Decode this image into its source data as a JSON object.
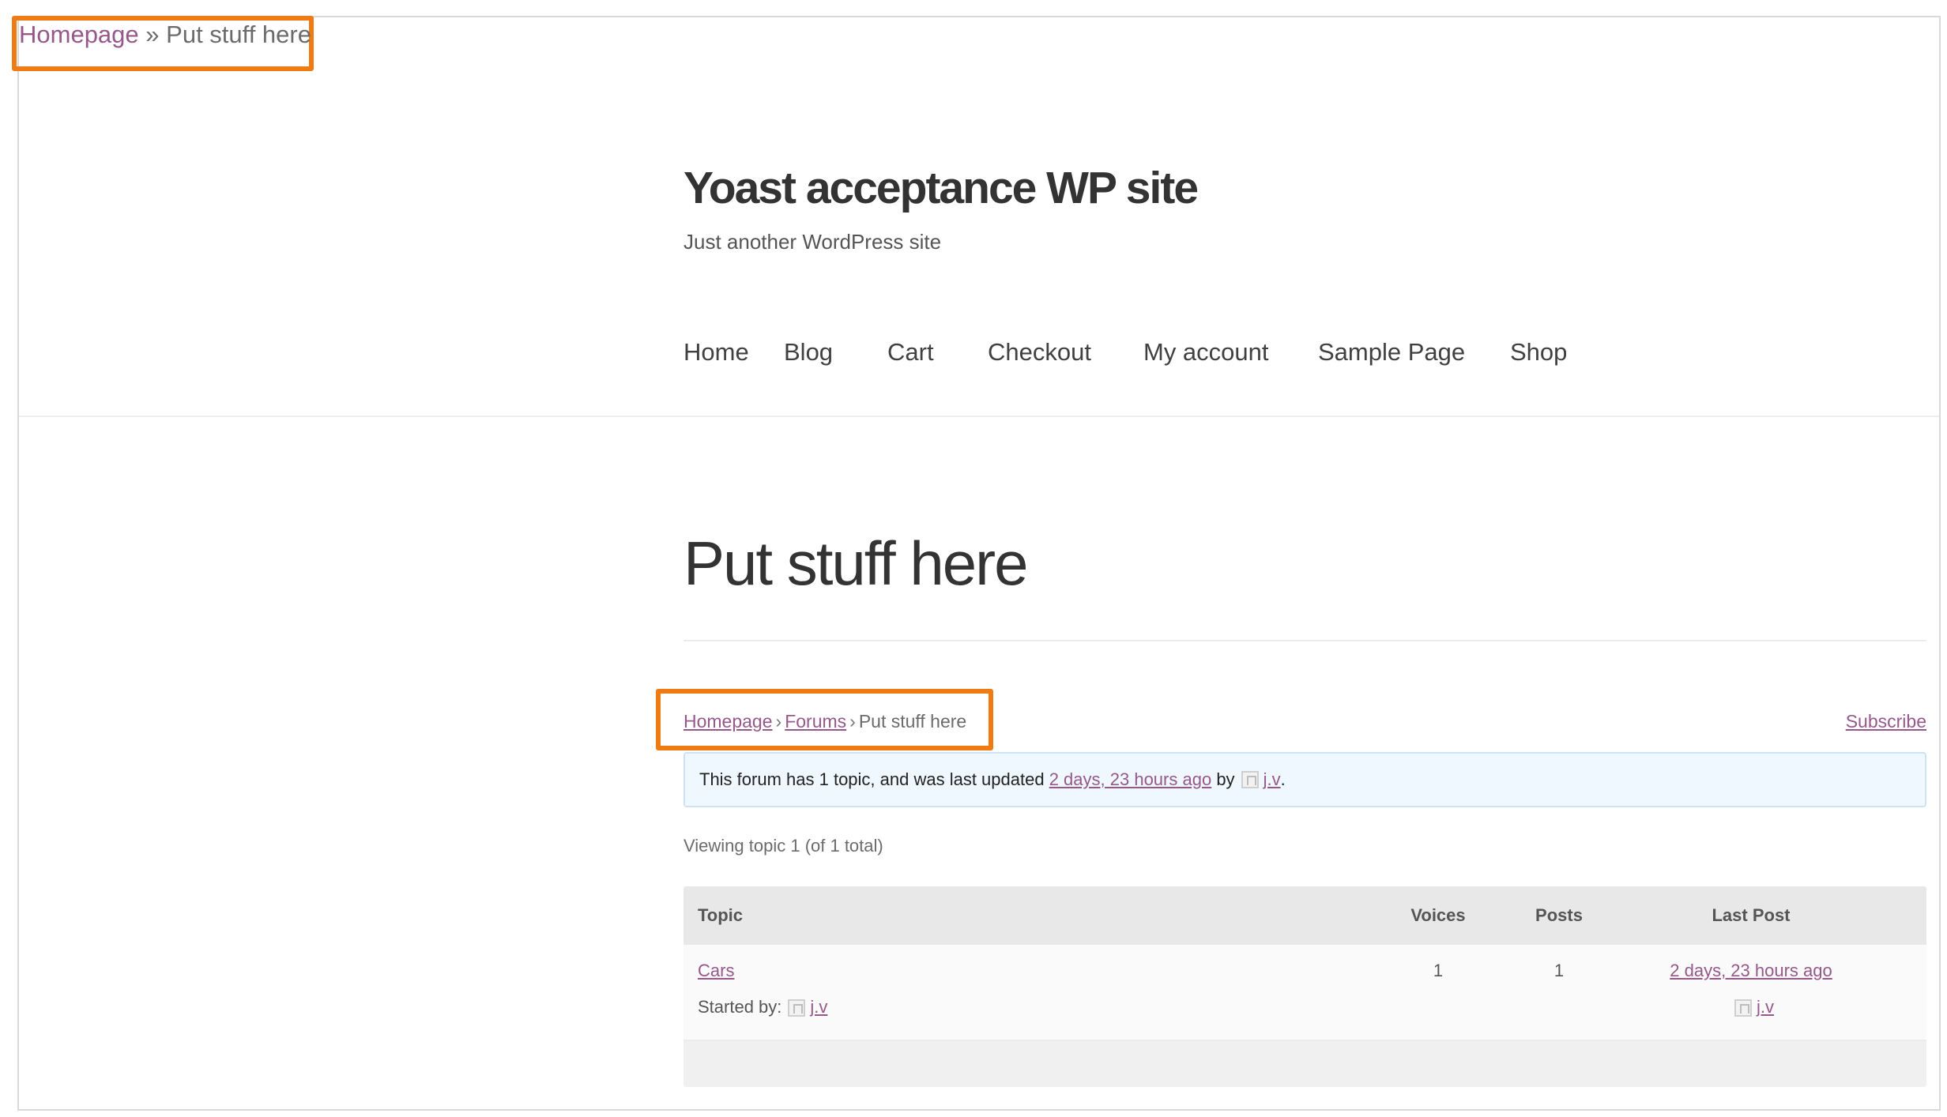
{
  "top_breadcrumb": {
    "home": "Homepage",
    "separator": "»",
    "current": "Put stuff here"
  },
  "site": {
    "title": "Yoast acceptance WP site",
    "description": "Just another WordPress site"
  },
  "nav": {
    "items": [
      "Home",
      "Blog",
      "Cart",
      "Checkout",
      "My account",
      "Sample Page",
      "Shop"
    ]
  },
  "page": {
    "title": "Put stuff here"
  },
  "forum_breadcrumb": {
    "home": "Homepage",
    "forums": "Forums",
    "current": "Put stuff here",
    "separator": "›"
  },
  "subscribe_label": "Subscribe",
  "notice": {
    "prefix": "This forum has 1 topic, and was last updated",
    "time": "2 days, 23 hours ago",
    "by": "by",
    "user": "j.v",
    "suffix": "."
  },
  "viewing_text": "Viewing topic 1 (of 1 total)",
  "table": {
    "headers": {
      "topic": "Topic",
      "voices": "Voices",
      "posts": "Posts",
      "last_post": "Last Post"
    },
    "rows": [
      {
        "title": "Cars",
        "started_by_label": "Started by:",
        "author": "j.v",
        "voices": "1",
        "posts": "1",
        "last_post_time": "2 days, 23 hours ago",
        "last_post_user": "j.v"
      }
    ]
  },
  "colors": {
    "link": "#96588a",
    "highlight": "#f07b12",
    "notice_bg": "#f0f8ff"
  }
}
